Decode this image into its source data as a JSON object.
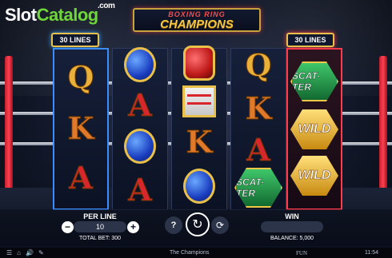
{
  "watermark": {
    "part1": "Slot",
    "part2": "Catalog",
    "suffix": ".com"
  },
  "title": {
    "line1": "BOXING RING",
    "line2": "CHAMPIONS"
  },
  "lines_left": "30 LINES",
  "lines_right": "30 LINES",
  "reels": [
    [
      "Q",
      "K",
      "A"
    ],
    [
      "blue-glove",
      "A",
      "blue-glove",
      "A"
    ],
    [
      "red-glove",
      "ring",
      "K",
      "blue-glove"
    ],
    [
      "Q",
      "K",
      "A",
      "SCATTER"
    ],
    [
      "SCATTER",
      "WILD",
      "WILD"
    ]
  ],
  "symbols": {
    "scatter": "SCAT-TER",
    "wild": "WILD"
  },
  "controls": {
    "per_line_label": "PER LINE",
    "per_line_value": "10",
    "minus": "−",
    "plus": "+",
    "total_bet": "TOTAL BET: 300",
    "info": "?",
    "spin": "↻",
    "autoplay": "⟳",
    "win_label": "WIN",
    "balance": "BALANCE: 5,000"
  },
  "footer": {
    "icons": [
      "☰",
      "⌂",
      "🔊",
      "✎"
    ],
    "game_name": "The Champions",
    "brand": "FUN",
    "time": "11:54"
  }
}
